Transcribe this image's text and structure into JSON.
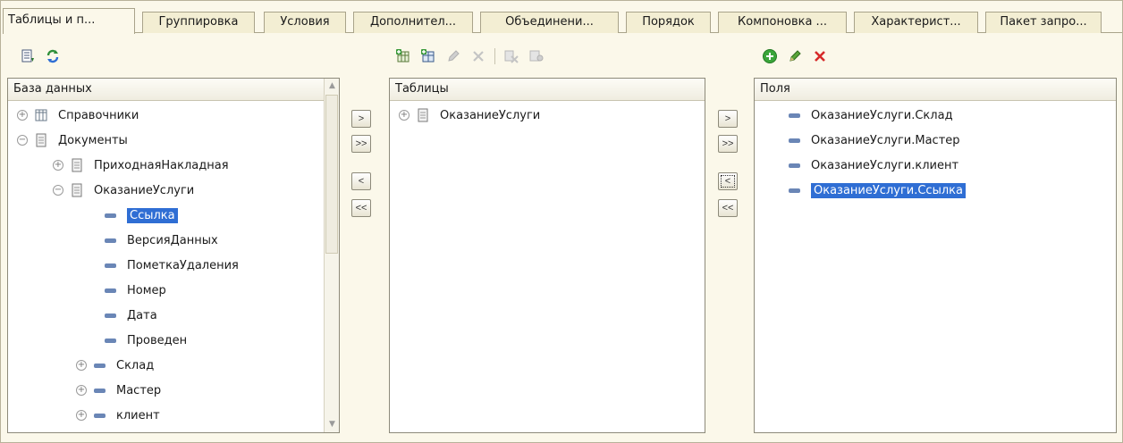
{
  "tabs": [
    "Таблицы и п...",
    "Группировка",
    "Условия",
    "Дополнител...",
    "Объединени...",
    "Порядок",
    "Компоновка ...",
    "Характерист...",
    "Пакет запро..."
  ],
  "db_panel": {
    "header": "База данных",
    "items": [
      "Справочники",
      "Документы",
      "ПриходнаяНакладная",
      "ОказаниеУслуги",
      "Ссылка",
      "ВерсияДанных",
      "ПометкаУдаления",
      "Номер",
      "Дата",
      "Проведен",
      "Склад",
      "Мастер",
      "клиент"
    ]
  },
  "tables_panel": {
    "header": "Таблицы",
    "items": [
      "ОказаниеУслуги"
    ]
  },
  "fields_panel": {
    "header": "Поля",
    "items": [
      "ОказаниеУслуги.Склад",
      "ОказаниеУслуги.Мастер",
      "ОказаниеУслуги.клиент",
      "ОказаниеУслуги.Ссылка"
    ]
  },
  "move_buttons": {
    "add": ">",
    "add_all": ">>",
    "remove": "<",
    "remove_all": "<<"
  },
  "icons": {
    "db_toolbar": [
      "list-icon",
      "refresh-icon"
    ],
    "tables_toolbar": [
      "add-table-icon",
      "add-temp-table-icon",
      "edit-icon",
      "delete-icon",
      "replace-table-icon",
      "settings-icon"
    ],
    "fields_toolbar": [
      "add-icon",
      "edit-icon",
      "delete-icon"
    ]
  },
  "colors": {
    "window_bg": "#fbf8ea",
    "selection": "#2f6ed4",
    "border": "#8d8a7a"
  }
}
